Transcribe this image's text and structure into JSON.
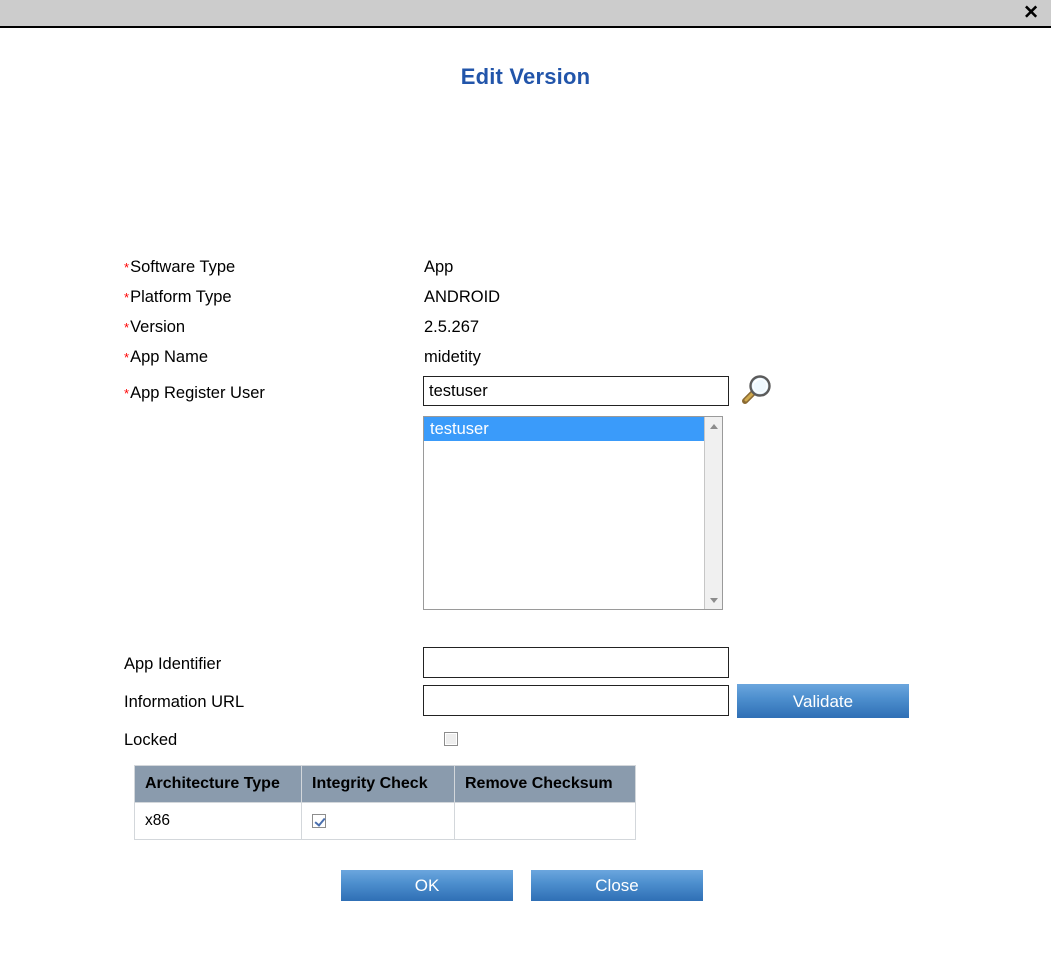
{
  "window": {
    "close_label": "✕",
    "close_icon": "close-x-icon"
  },
  "dialog": {
    "title": "Edit Version"
  },
  "fields": [
    {
      "label": "Software Type",
      "required": true,
      "value": "App"
    },
    {
      "label": "Platform Type",
      "required": true,
      "value": "ANDROID"
    },
    {
      "label": "Version",
      "required": true,
      "value": "2.5.267"
    },
    {
      "label": "App Name",
      "required": true,
      "value": "midetity"
    },
    {
      "label": "App Register User",
      "required": true,
      "value": ""
    },
    {
      "label": "App Identifier",
      "required": false,
      "value": ""
    },
    {
      "label": "Information URL",
      "required": false,
      "value": ""
    },
    {
      "label": "Locked",
      "required": false,
      "value": ""
    }
  ],
  "register_user": {
    "input_value": "testuser",
    "placeholder": "",
    "search_icon": "magnifier-icon",
    "results": [
      {
        "label": "testuser",
        "selected": true
      }
    ]
  },
  "app_identifier": {
    "value": "",
    "placeholder": ""
  },
  "information_url": {
    "value": "",
    "placeholder": "",
    "validate_label": "Validate"
  },
  "locked": {
    "checked": false
  },
  "arch_table": {
    "columns": [
      "Architecture Type",
      "Integrity Check",
      "Remove Checksum"
    ],
    "rows": [
      {
        "architecture_type": "x86",
        "integrity_check": true,
        "remove_checksum": ""
      }
    ]
  },
  "footer": {
    "ok_label": "OK",
    "close_label": "Close"
  },
  "colors": {
    "title_blue": "#2255aa",
    "button_blue": "#4d8fce",
    "required_red": "#ff0000",
    "titlebar_grey": "#cccccc",
    "table_header": "#8a9bad",
    "selection_blue": "#3a9bfa"
  }
}
